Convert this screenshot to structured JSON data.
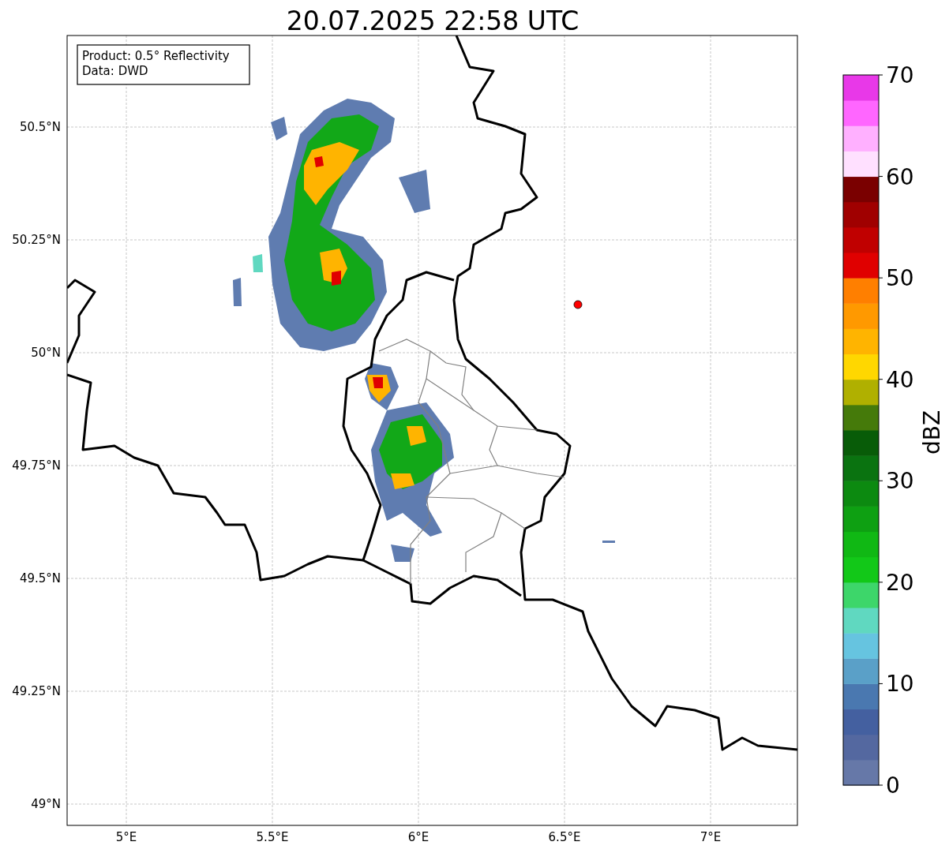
{
  "title": "20.07.2025 22:58 UTC",
  "map": {
    "info_lines": [
      "Product: 0.5° Reflectivity",
      "Data: DWD"
    ],
    "lat_ticks": [
      "50.5°N",
      "50.25°N",
      "50°N",
      "49.75°N",
      "49.5°N",
      "49.25°N",
      "49°N"
    ],
    "lon_ticks": [
      "5°E",
      "5.5°E",
      "6°E",
      "6.5°E",
      "7°E"
    ]
  },
  "colorbar": {
    "label": "dBZ",
    "ticks": [
      "70",
      "60",
      "50",
      "40",
      "30",
      "20",
      "10",
      "0"
    ],
    "bins": [
      {
        "color": "#6678a8"
      },
      {
        "color": "#5468a0"
      },
      {
        "color": "#4460a0"
      },
      {
        "color": "#4a78b0"
      },
      {
        "color": "#5aa0c8"
      },
      {
        "color": "#66c4e0"
      },
      {
        "color": "#60d8c0"
      },
      {
        "color": "#3dd66a"
      },
      {
        "color": "#12c818"
      },
      {
        "color": "#10b814"
      },
      {
        "color": "#0ea012"
      },
      {
        "color": "#0c8a10"
      },
      {
        "color": "#0a7310"
      },
      {
        "color": "#085c08"
      },
      {
        "color": "#457a0a"
      },
      {
        "color": "#b0b000"
      },
      {
        "color": "#ffd700"
      },
      {
        "color": "#ffb400"
      },
      {
        "color": "#ff9900"
      },
      {
        "color": "#ff7f00"
      },
      {
        "color": "#e00000"
      },
      {
        "color": "#c00000"
      },
      {
        "color": "#a00000"
      },
      {
        "color": "#7a0000"
      },
      {
        "color": "#ffe0ff"
      },
      {
        "color": "#ffb0ff"
      },
      {
        "color": "#ff66ff"
      },
      {
        "color": "#e838e8"
      }
    ]
  }
}
